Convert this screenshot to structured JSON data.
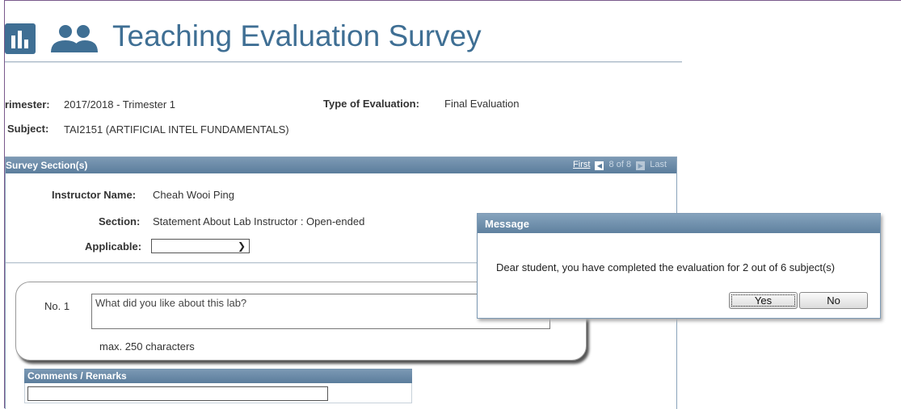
{
  "header": {
    "title": "Teaching Evaluation Survey",
    "logo_icon": "bar-chart-icon",
    "people_icon": "people-icon",
    "accent_color": "#3f6f94"
  },
  "info": {
    "trimester_label": "rimester:",
    "trimester_value": "2017/2018 - Trimester 1",
    "type_label": "Type of Evaluation:",
    "type_value": "Final Evaluation",
    "subject_label": "Subject:",
    "subject_value": "TAI2151 (ARTIFICIAL INTEL FUNDAMENTALS)"
  },
  "survey": {
    "panel_title": "Survey Section(s)",
    "pager": {
      "first": "First",
      "status": "8 of 8",
      "last": "Last"
    },
    "instructor_label": "Instructor Name:",
    "instructor_value": "Cheah Wooi Ping",
    "section_label": "Section:",
    "section_value": "Statement About Lab Instructor : Open-ended",
    "applicable_label": "Applicable:",
    "applicable_value": ""
  },
  "question": {
    "number": "No. 1",
    "text": "What did you like about this lab?",
    "hint": "max. 250 characters"
  },
  "comments": {
    "title": "Comments / Remarks",
    "value": ""
  },
  "dialog": {
    "title": "Message",
    "message": "Dear student, you have completed the evaluation for 2 out of 6 subject(s)",
    "yes": "Yes",
    "no": "No"
  }
}
